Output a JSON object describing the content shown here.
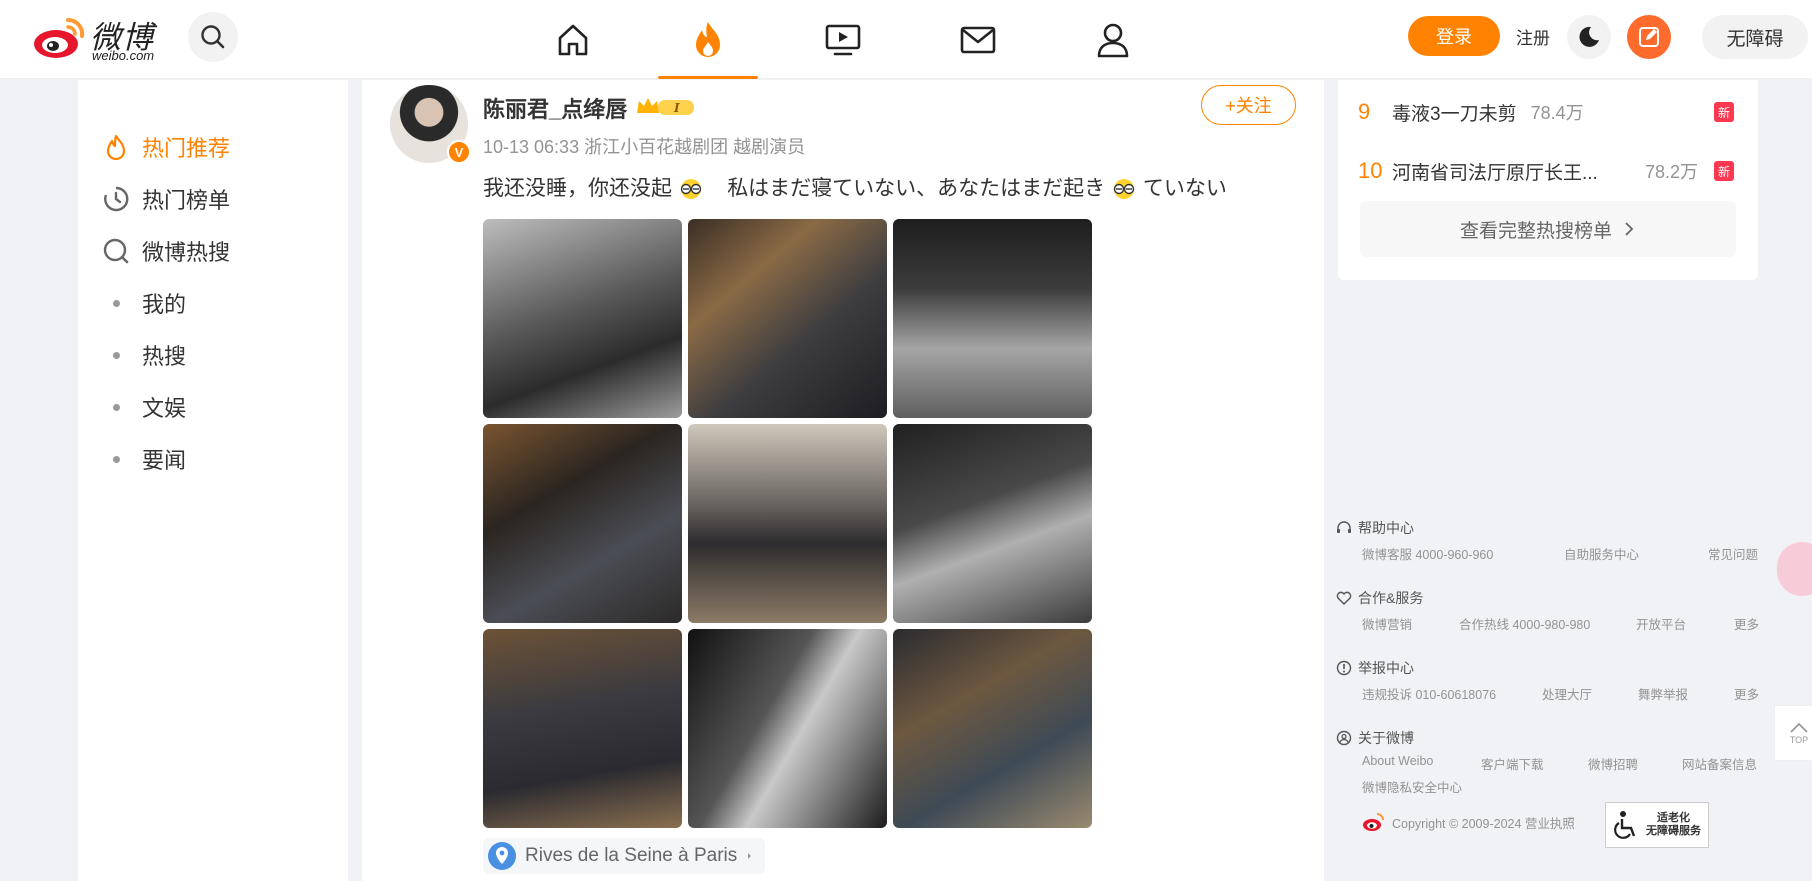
{
  "header": {
    "logo_text": "微博",
    "logo_sub": "weibo.com",
    "login_label": "登录",
    "register_label": "注册",
    "accessibility_label": "无障碍"
  },
  "sidebar": {
    "items": [
      {
        "label": "热门推荐",
        "icon": "fire-icon",
        "active": true
      },
      {
        "label": "热门榜单",
        "icon": "clock-icon"
      },
      {
        "label": "微博热搜",
        "icon": "search-icon"
      },
      {
        "label": "我的"
      },
      {
        "label": "热搜"
      },
      {
        "label": "文娱"
      },
      {
        "label": "要闻"
      }
    ]
  },
  "post": {
    "user_name": "陈丽君_点绛唇",
    "meta": "10-13 06:33  浙江小百花越剧团 越剧演员",
    "follow_label": "+关注",
    "text_part1": "我还没睡，你还没起",
    "text_part2": "私はまだ寝ていない、あなたはまだ起き",
    "text_part3": "ていない",
    "location": "Rives de la Seine à Paris"
  },
  "hot_list": {
    "items": [
      {
        "rank": "9",
        "title": "毒液3一刀未剪",
        "count": "78.4万",
        "tag": "新"
      },
      {
        "rank": "10",
        "title": "河南省司法厅原厅长王...",
        "count": "78.2万",
        "tag": "新"
      }
    ],
    "more_label": "查看完整热搜榜单"
  },
  "footer": {
    "help": {
      "title": "帮助中心",
      "links": [
        "微博客服 4000-960-960",
        "自助服务中心",
        "常见问题"
      ]
    },
    "coop": {
      "title": "合作&服务",
      "links": [
        "微博营销",
        "合作热线 4000-980-980",
        "开放平台",
        "更多"
      ]
    },
    "report": {
      "title": "举报中心",
      "links": [
        "违规投诉 010-60618076",
        "处理大厅",
        "舞弊举报",
        "更多"
      ]
    },
    "about": {
      "title": "关于微博",
      "links": [
        "About Weibo",
        "客户端下载",
        "微博招聘",
        "网站备案信息"
      ],
      "extra": "微博隐私安全中心"
    },
    "copyright": "Copyright © 2009-2024 营业执照",
    "elder_line1": "适老化",
    "elder_line2": "无障碍服务"
  },
  "top_label": "TOP",
  "colors": {
    "accent": "#ff8200",
    "hot_tag": "#ff3852",
    "compose": "#ff6b2c"
  }
}
